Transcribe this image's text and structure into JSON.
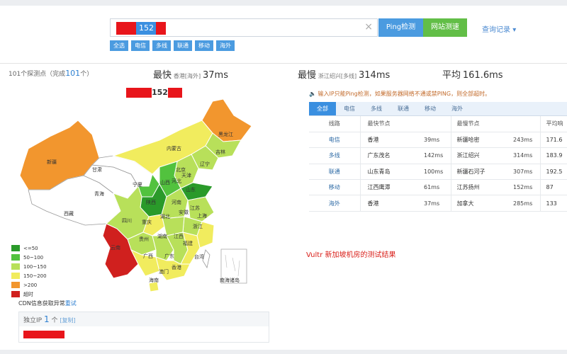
{
  "search": {
    "ip_visible": "152",
    "clear_glyph": "×",
    "ping_button": "Ping检测",
    "speed_button": "网站测速",
    "history": "查询记录",
    "history_arrow": "▾",
    "filters": [
      "全选",
      "电信",
      "多线",
      "联通",
      "移动",
      "海外"
    ]
  },
  "stats": {
    "probe_label": "101个探测点（完成",
    "probe_done": "101",
    "probe_suffix": "个）",
    "fastest_label": "最快",
    "fastest_loc": "香港[海外]",
    "fastest_value": "37ms",
    "slowest_label": "最慢",
    "slowest_loc": "浙江绍兴[多线]",
    "slowest_value": "314ms",
    "avg_label": "平均",
    "avg_value": "161.6ms"
  },
  "map": {
    "ip_visible": "152",
    "provinces": [
      "新疆",
      "西藏",
      "青海",
      "甘肃",
      "内蒙古",
      "黑龙江",
      "吉林",
      "辽宁",
      "北京",
      "天津",
      "河北",
      "山西",
      "宁夏",
      "陕西",
      "山东",
      "河南",
      "江苏",
      "安徽",
      "上海",
      "四川",
      "重庆",
      "湖北",
      "浙江",
      "贵州",
      "湖南",
      "江西",
      "福建",
      "云南",
      "广西",
      "广东",
      "台湾",
      "海南",
      "香港",
      "澳门",
      "南海诸岛"
    ]
  },
  "legend": [
    {
      "label": "<=50",
      "color": "#2a9a2a"
    },
    {
      "label": "50~100",
      "color": "#52c23e"
    },
    {
      "label": "100~150",
      "color": "#b8e05a"
    },
    {
      "label": "150~200",
      "color": "#f1ec5e"
    },
    {
      "label": ">200",
      "color": "#f2962e"
    },
    {
      "label": "超时",
      "color": "#d0201e"
    }
  ],
  "cdn": {
    "text": "CDN信息获取异常",
    "retry": "重试"
  },
  "ip_box": {
    "label": "独立IP",
    "count": "1",
    "unit": "个",
    "copy": "[复制]"
  },
  "notice": "输入IP只能Ping检测，如果服务器网络不通或禁PING，则全部超时。",
  "tabs": [
    "全部",
    "电信",
    "多线",
    "联通",
    "移动",
    "海外"
  ],
  "table": {
    "headers": [
      "线路",
      "最快节点",
      "最慢节点",
      "平均响"
    ],
    "rows": [
      {
        "line": "电信",
        "fast_node": "香港",
        "fast_ms": "39ms",
        "slow_node": "新疆哈密",
        "slow_ms": "243ms",
        "avg": "171.6"
      },
      {
        "line": "多线",
        "fast_node": "广东茂名",
        "fast_ms": "142ms",
        "slow_node": "浙江绍兴",
        "slow_ms": "314ms",
        "avg": "183.9"
      },
      {
        "line": "联通",
        "fast_node": "山东青岛",
        "fast_ms": "100ms",
        "slow_node": "新疆石河子",
        "slow_ms": "307ms",
        "avg": "192.5"
      },
      {
        "line": "移动",
        "fast_node": "江西鹰潭",
        "fast_ms": "61ms",
        "slow_node": "江苏扬州",
        "slow_ms": "152ms",
        "avg": "87"
      },
      {
        "line": "海外",
        "fast_node": "香港",
        "fast_ms": "37ms",
        "slow_node": "加拿大",
        "slow_ms": "285ms",
        "avg": "133"
      }
    ]
  },
  "caption": "Vultr 新加坡机房的测试结果"
}
